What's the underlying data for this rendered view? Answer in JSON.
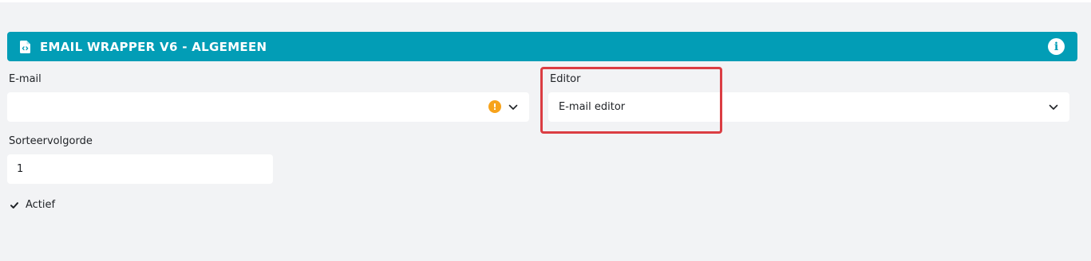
{
  "section": {
    "title": "EMAIL WRAPPER V6 - ALGEMEEN",
    "icon": "file-code-icon",
    "info_icon": "info-icon",
    "info_glyph": "i",
    "color": "#029db6"
  },
  "fields": {
    "email": {
      "label": "E-mail",
      "value": "",
      "status": "warning",
      "warning_glyph": "!",
      "warning_color": "#f7a31c"
    },
    "editor": {
      "label": "Editor",
      "value": "E-mail editor"
    },
    "sort_order": {
      "label": "Sorteervolgorde",
      "value": "1"
    },
    "active": {
      "label": "Actief",
      "checked": true
    }
  },
  "highlight_color": "#db3d43"
}
